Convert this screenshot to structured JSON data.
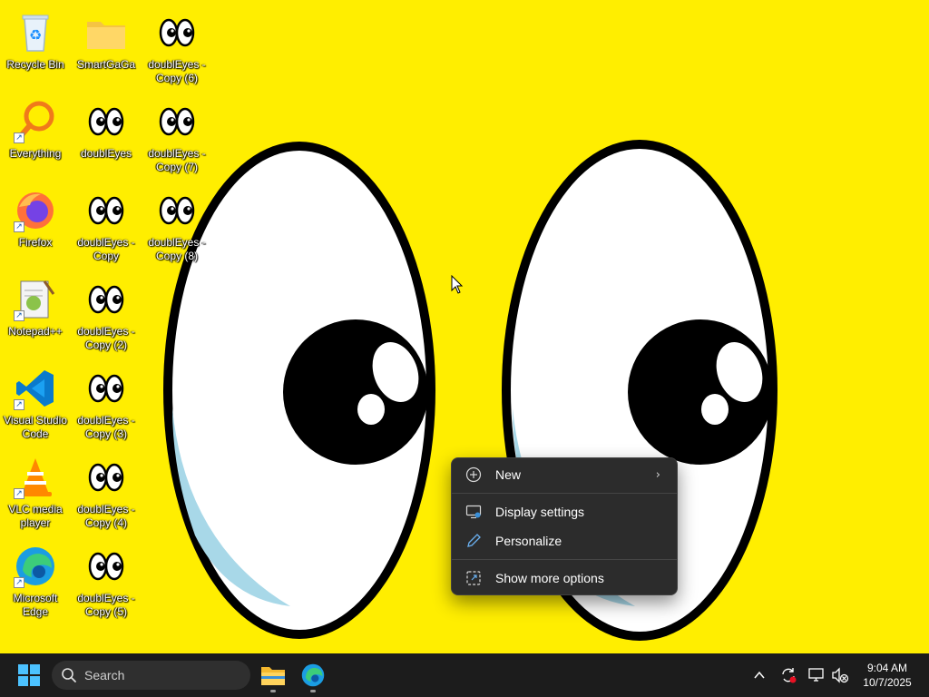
{
  "desktop": {
    "icons": [
      {
        "label": "Recycle Bin",
        "icon": "recycle-bin-icon"
      },
      {
        "label": "SmartGaGa",
        "icon": "folder-icon"
      },
      {
        "label": "doublEyes - Copy (6)",
        "icon": "double-eyes-icon"
      },
      {
        "label": "Everything",
        "icon": "everything-search-icon"
      },
      {
        "label": "doublEyes",
        "icon": "double-eyes-icon"
      },
      {
        "label": "doublEyes - Copy (7)",
        "icon": "double-eyes-icon"
      },
      {
        "label": "Firefox",
        "icon": "firefox-icon"
      },
      {
        "label": "doublEyes - Copy",
        "icon": "double-eyes-icon"
      },
      {
        "label": "doublEyes - Copy (8)",
        "icon": "double-eyes-icon"
      },
      {
        "label": "Notepad++",
        "icon": "notepad-plus-plus-icon"
      },
      {
        "label": "doublEyes - Copy (2)",
        "icon": "double-eyes-icon"
      },
      {
        "label": "Visual Studio Code",
        "icon": "vscode-icon"
      },
      {
        "label": "doublEyes - Copy (3)",
        "icon": "double-eyes-icon"
      },
      {
        "label": "VLC media player",
        "icon": "vlc-icon"
      },
      {
        "label": "doublEyes - Copy (4)",
        "icon": "double-eyes-icon"
      },
      {
        "label": "Microsoft Edge",
        "icon": "edge-icon"
      },
      {
        "label": "doublEyes - Copy (5)",
        "icon": "double-eyes-icon"
      }
    ]
  },
  "context_menu": {
    "items": [
      {
        "label": "New",
        "icon": "new-plus-icon",
        "has_submenu": true
      },
      {
        "label": "Display settings",
        "icon": "display-settings-icon"
      },
      {
        "label": "Personalize",
        "icon": "pen-icon"
      },
      {
        "label": "Show more options",
        "icon": "show-more-options-icon"
      }
    ]
  },
  "taskbar": {
    "search_placeholder": "Search",
    "pinned_apps": [
      {
        "name": "File Explorer",
        "icon": "file-explorer-icon"
      },
      {
        "name": "Microsoft Edge",
        "icon": "edge-icon"
      }
    ],
    "tray_icons": [
      "chevron-up-icon",
      "sync-icon",
      "network-icon",
      "volume-muted-icon"
    ],
    "clock": {
      "time": "9:04 AM",
      "date": "10/7/2025"
    }
  },
  "colors": {
    "wallpaper": "#ffee00",
    "taskbar": "#1c1c1c",
    "menu_bg": "#2c2c2c",
    "accent": "#0078d4"
  }
}
